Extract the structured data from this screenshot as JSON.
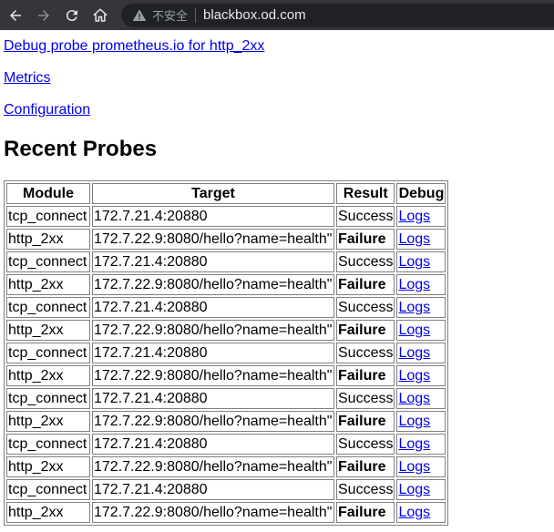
{
  "browser": {
    "insecure_label": "不安全",
    "url": "blackbox.od.com"
  },
  "links": {
    "debug": "Debug probe prometheus.io for http_2xx",
    "metrics": "Metrics",
    "configuration": "Configuration"
  },
  "heading": "Recent Probes",
  "table": {
    "headers": [
      "Module",
      "Target",
      "Result",
      "Debug"
    ],
    "rows": [
      {
        "module": "tcp_connect",
        "target": "172.7.21.4:20880",
        "result": "Success",
        "debug": "Logs"
      },
      {
        "module": "http_2xx",
        "target": "172.7.22.9:8080/hello?name=health\"",
        "result": "Failure",
        "debug": "Logs"
      },
      {
        "module": "tcp_connect",
        "target": "172.7.21.4:20880",
        "result": "Success",
        "debug": "Logs"
      },
      {
        "module": "http_2xx",
        "target": "172.7.22.9:8080/hello?name=health\"",
        "result": "Failure",
        "debug": "Logs"
      },
      {
        "module": "tcp_connect",
        "target": "172.7.21.4:20880",
        "result": "Success",
        "debug": "Logs"
      },
      {
        "module": "http_2xx",
        "target": "172.7.22.9:8080/hello?name=health\"",
        "result": "Failure",
        "debug": "Logs"
      },
      {
        "module": "tcp_connect",
        "target": "172.7.21.4:20880",
        "result": "Success",
        "debug": "Logs"
      },
      {
        "module": "http_2xx",
        "target": "172.7.22.9:8080/hello?name=health\"",
        "result": "Failure",
        "debug": "Logs"
      },
      {
        "module": "tcp_connect",
        "target": "172.7.21.4:20880",
        "result": "Success",
        "debug": "Logs"
      },
      {
        "module": "http_2xx",
        "target": "172.7.22.9:8080/hello?name=health\"",
        "result": "Failure",
        "debug": "Logs"
      },
      {
        "module": "tcp_connect",
        "target": "172.7.21.4:20880",
        "result": "Success",
        "debug": "Logs"
      },
      {
        "module": "http_2xx",
        "target": "172.7.22.9:8080/hello?name=health\"",
        "result": "Failure",
        "debug": "Logs"
      },
      {
        "module": "tcp_connect",
        "target": "172.7.21.4:20880",
        "result": "Success",
        "debug": "Logs"
      },
      {
        "module": "http_2xx",
        "target": "172.7.22.9:8080/hello?name=health\"",
        "result": "Failure",
        "debug": "Logs"
      }
    ]
  }
}
